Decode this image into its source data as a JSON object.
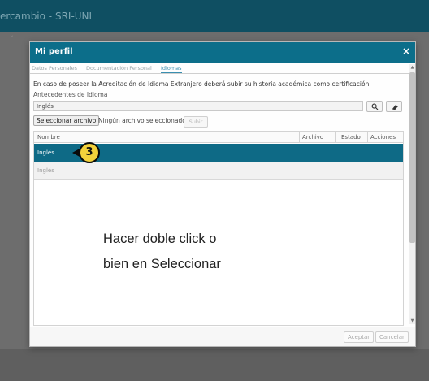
{
  "background_app": {
    "title": "ercambio - SRI-UNL",
    "chevron": "˅"
  },
  "modal": {
    "title": "Mi perfil",
    "close_label": "×",
    "tabs": [
      {
        "label": "Datos Personales",
        "active": false
      },
      {
        "label": "Documentación Personal",
        "active": false
      },
      {
        "label": "Idiomas",
        "active": true
      }
    ],
    "info_text": "En caso de poseer la Acreditación de Idioma Extranjero deberá subir su historia académica como certificación.",
    "field_label": "Antecedentes de Idioma",
    "language_input_value": "Inglés",
    "search_icon": "search-icon",
    "clear_icon": "eraser-icon",
    "file_button_label": "Seleccionar archivo",
    "file_status": "Ningún archivo seleccionado",
    "upload_label": "Subir",
    "table": {
      "columns": [
        "Nombre",
        "Archivo",
        "Estado",
        "Acciones"
      ],
      "rows": [
        {
          "nombre": "Inglés",
          "selected": true
        },
        {
          "nombre": "Inglés",
          "selected": false
        }
      ]
    },
    "step_badge": "3",
    "instruction_line1": "Hacer doble click o",
    "instruction_line2": "bien en Seleccionar",
    "footer": {
      "accept_label": "Aceptar",
      "cancel_label": "Cancelar"
    }
  },
  "colors": {
    "header": "#0c6e8a",
    "selected_row": "#0e6a86",
    "badge": "#f3d23b",
    "top_bar": "#0f4f62"
  }
}
